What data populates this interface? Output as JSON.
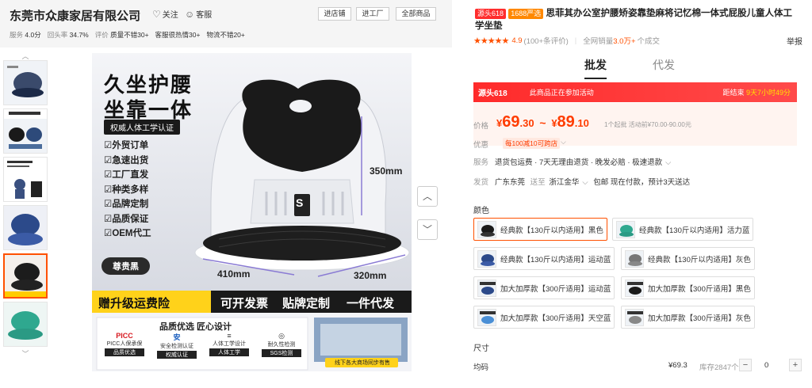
{
  "shop": {
    "name": "东莞市众康家居有限公司",
    "follow": "关注",
    "service": "客服",
    "buttons": [
      "进店铺",
      "进工厂",
      "全部商品"
    ],
    "metrics": [
      {
        "label": "服务",
        "value": "4.0分"
      },
      {
        "label": "回头率",
        "value": "34.7%"
      },
      {
        "label": "评价",
        "value": "质量不错30+"
      },
      {
        "label": "",
        "value": "客服很热情30+"
      },
      {
        "label": "",
        "value": "物流不错20+"
      }
    ]
  },
  "product_image": {
    "headline1": "久坐护腰",
    "headline2": "坐靠一体",
    "cert": "权威人体工学认证",
    "features": [
      "外贸订单",
      "急速出货",
      "工厂直发",
      "种类多样",
      "品牌定制",
      "品质保证",
      "OEM代工"
    ],
    "dim_h": "350mm",
    "dim_w": "410mm",
    "dim_d": "320mm",
    "model": "尊贵黑",
    "logo": "S",
    "banner": [
      "赠升级运费险",
      "可开发票",
      "贴牌定制",
      "一件代发"
    ],
    "quality_title": "品质优选 匠心设计",
    "badges": [
      {
        "icon": "PICC",
        "text": "PICC人保承保",
        "tag": "品质优选"
      },
      {
        "icon": "安",
        "text": "安全检测认证",
        "tag": "权威认证"
      },
      {
        "icon": "≡",
        "text": "人体工学设计",
        "tag": "人体工学"
      },
      {
        "icon": "◎",
        "text": "耐久性检测",
        "tag": "SGS检测"
      }
    ],
    "factory_tag": "线下各大商场同步有售"
  },
  "product": {
    "badge1": "源头618",
    "badge2": "1688严选",
    "title": "思菲其办公室护腰矫姿靠垫麻将记忆棉一体式屁股儿童人体工学坐垫",
    "rating": "4.9",
    "reviews": "(100+条评价)",
    "sales_prefix": "全网销量",
    "sales": "3.0万+",
    "sales_suffix": "个成交",
    "report": "举报"
  },
  "tabs": [
    "批发",
    "代发"
  ],
  "promo": {
    "tag": "源头618",
    "middle": "此商品正在参加活动",
    "right_prefix": "距结束",
    "countdown": "9天7小时49分"
  },
  "price": {
    "label": "价格",
    "currency": "¥",
    "low_int": "69",
    "low_dec": ".30",
    "sep": "~",
    "high_int": "89",
    "high_dec": ".10",
    "note": "1个起批 活动前¥70.00-90.00元",
    "offer_label": "优惠",
    "coupon": "每100减10可跨店"
  },
  "service_row": {
    "label": "服务",
    "text": "退货包运费 · 7天无理由退货 · 晚发必赔 · 极速退款"
  },
  "ship_row": {
    "label": "发货",
    "from": "广东东莞",
    "to_label": "送至",
    "to": "浙江金华",
    "text": "包邮 现在付款，预计3天送达"
  },
  "colors": {
    "label": "颜色",
    "options": [
      "经典款【130斤以内适用】黑色",
      "经典款【130斤以内适用】活力蓝",
      "经典款【130斤以内适用】运动蓝",
      "经典款【130斤以内适用】灰色",
      "加大加厚款【300斤适用】运动蓝",
      "加大加厚款【300斤适用】黑色",
      "加大加厚款【300斤适用】天空蓝",
      "加大加厚款【300斤适用】灰色"
    ]
  },
  "size": {
    "label": "尺寸",
    "item": "均码",
    "price": "¥69.3",
    "stock": "库存2847个",
    "qty": "0"
  },
  "accent": "#ff5000"
}
